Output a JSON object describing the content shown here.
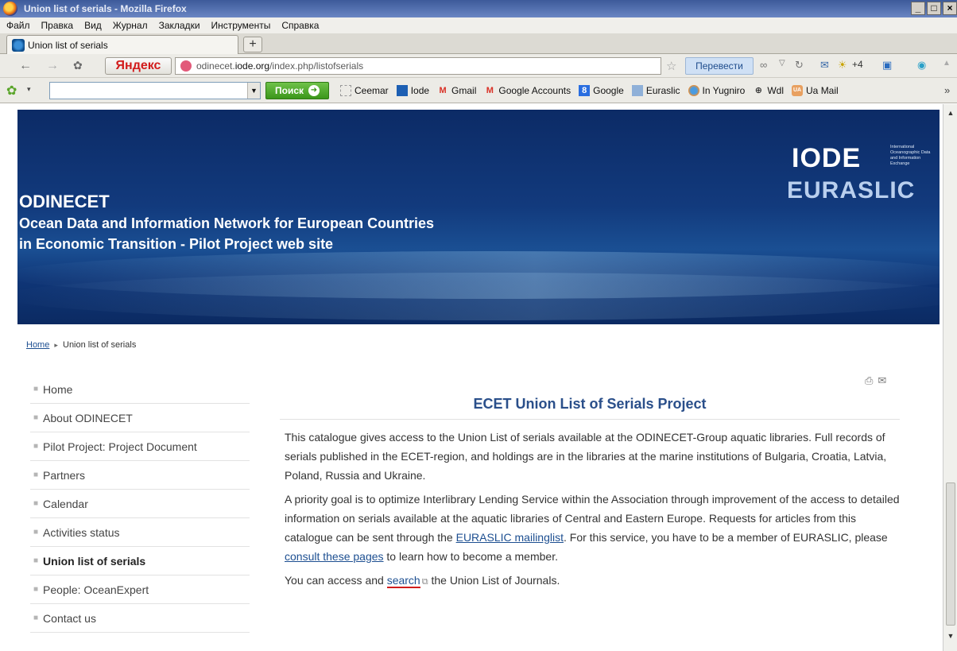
{
  "window": {
    "title": "Union list of serials - Mozilla Firefox",
    "buttons": [
      "_",
      "□",
      "×"
    ]
  },
  "menu": {
    "items": [
      "Файл",
      "Правка",
      "Вид",
      "Журнал",
      "Закладки",
      "Инструменты",
      "Справка"
    ]
  },
  "tab": {
    "label": "Union list of serials",
    "new_tab": "+"
  },
  "nav": {
    "yandex_label": "Яндекс",
    "url_prefix": "odinecet.",
    "url_domain": "iode.org",
    "url_path": "/index.php/listofserials",
    "translate_label": "Перевести",
    "extra_count": "+4"
  },
  "bookmarks_bar": {
    "search_label": "Поиск",
    "items": [
      {
        "label": "Ceemar",
        "icon": "page-icon"
      },
      {
        "label": "Iode",
        "icon": "bookmark-icon"
      },
      {
        "label": "Gmail",
        "icon": "gmail-icon"
      },
      {
        "label": "Google Accounts",
        "icon": "gmail-icon"
      },
      {
        "label": "Google",
        "icon": "google-icon"
      },
      {
        "label": "Euraslic",
        "icon": "euraslic-icon"
      },
      {
        "label": "In Yugniro",
        "icon": "firefox-icon"
      },
      {
        "label": "Wdl",
        "icon": "globe-icon"
      },
      {
        "label": "Ua Mail",
        "icon": "mail-icon"
      }
    ],
    "overflow": "»"
  },
  "banner": {
    "title": "ODINECET",
    "subtitle_line1": "Ocean Data and Information Network for European Countries",
    "subtitle_line2": "in Economic Transition - Pilot Project web site",
    "logo_iode": "IODE",
    "logo_iode_small": "International Oceanographic Data and Information Exchange",
    "logo_euraslic": "EURASLIC"
  },
  "breadcrumb": {
    "home": "Home",
    "separator": "▸",
    "current": "Union list of serials"
  },
  "sidebar": {
    "items": [
      {
        "label": "Home"
      },
      {
        "label": "About ODINECET"
      },
      {
        "label": "Pilot Project: Project Document"
      },
      {
        "label": "Partners"
      },
      {
        "label": "Calendar"
      },
      {
        "label": "Activities status"
      },
      {
        "label": "Union list of serials",
        "active": true
      },
      {
        "label": "People: OceanExpert"
      },
      {
        "label": "Contact us"
      }
    ]
  },
  "content": {
    "heading": "ECET Union List of Serials Project",
    "p1": "This catalogue gives access to the Union List of serials available at the ODINECET-Group aquatic libraries. Full records of serials published in the ECET-region, and holdings are in the libraries at the marine institutions of Bulgaria, Croatia, Latvia, Poland, Russia and Ukraine.",
    "p2_part1": "A priority goal is to optimize Interlibrary Lending Service within the Association through improvement of the access to detailed information on serials available at the aquatic libraries of Central and Eastern Europe. Requests for articles from this catalogue can be sent through the ",
    "p2_link1": "EURASLIC mailinglist",
    "p2_part2": ". For this service, you have to be a member of EURASLIC, please ",
    "p2_link2": "consult these pages",
    "p2_part3": " to learn how to become a member.",
    "p3_part1": "You can access and ",
    "p3_link": "search",
    "p3_part2": " the Union List of Journals."
  }
}
